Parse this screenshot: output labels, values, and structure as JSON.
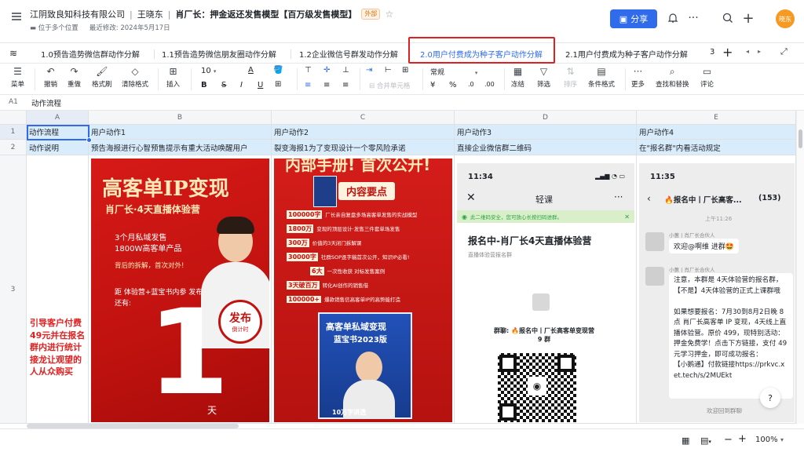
{
  "header": {
    "org": "江阴致良知科技有限公司",
    "author": "王晓东",
    "doc_title": "肖厂长：押金返还发售模型【百万级发售模型】",
    "badge": "外部",
    "location": "位于多个位置",
    "modified": "最近修改: 2024年5月17日",
    "share_label": "分享",
    "avatar_text": "晓东"
  },
  "tabs": [
    {
      "label": "1.0预告造势微信群动作分解"
    },
    {
      "label": "1.1预告造势微信朋友圈动作分解"
    },
    {
      "label": "1.2企业微信号群发动作分解"
    },
    {
      "label": "2.0用户付费成为种子客户动作分解"
    },
    {
      "label": "2.1用户付费成为种子客户动作分解"
    },
    {
      "label": "3"
    }
  ],
  "toolbar": {
    "menu": "菜单",
    "undo": "撤销",
    "redo": "重做",
    "format_brush": "格式刷",
    "clear_format": "清除格式",
    "insert": "插入",
    "font_size": "10",
    "merge": "合并单元格",
    "number_format": "常规",
    "freeze": "冻结",
    "filter": "筛选",
    "sort": "排序",
    "cond_format": "条件格式",
    "more": "更多",
    "find_replace": "查找和替换",
    "comment": "评论"
  },
  "formula_bar": {
    "ref": "A1",
    "value": "动作流程"
  },
  "columns": [
    "A",
    "B",
    "C",
    "D",
    "E"
  ],
  "rows": [
    {
      "num": "1",
      "cells": [
        "动作流程",
        "用户动作1",
        "用户动作2",
        "用户动作3",
        "用户动作4"
      ]
    },
    {
      "num": "2",
      "cells": [
        "动作说明",
        "预告海报进行心智预售提示有重大活动唤醒用户",
        "裂变海报1为了变现设计一个零风险承诺",
        "直接企业微信群二维码",
        "在\"报名群\"内看活动规定"
      ]
    },
    {
      "num": "3",
      "cells": [
        "引导客户付费49元并在报名群内进行统计接龙让观望的人从众购买"
      ]
    }
  ],
  "poster1": {
    "title": "高客单IP变现",
    "sub": "肖厂长·4天直播体验营",
    "line1": "3个月私域发售",
    "line2": "1800W高客单产品",
    "line3": "背后的拆解，首次对外!",
    "line4": "距 体验营+蓝宝书内参 发布",
    "line5": "还有:",
    "big": "1",
    "unit": "天",
    "seal": "发布",
    "seal_sub": "倒计时"
  },
  "poster2": {
    "top": "内部手册! 首次公开!",
    "header": "内容要点",
    "items": [
      {
        "tag": "100000字",
        "text": "厂长亲自复盘多场高客单发售的实战模型"
      },
      {
        "tag": "1800万",
        "text": "变现的顶层设计·发售三件套单场发售"
      },
      {
        "tag": "300万",
        "text": "价值的3天闭门拆解课"
      },
      {
        "tag": "30000字",
        "text": "社群SOP逐字稿首次公开，知识IP必看!"
      },
      {
        "tag": "6大",
        "text": "一次性收获 对标发售案例"
      },
      {
        "tag": "3天破百万",
        "text": "转化AI创作的销售借"
      },
      {
        "tag": "100000+",
        "text": "爆款销售信高客单IP的高势能打造"
      }
    ],
    "book": "高客单私域变现",
    "book2": "蓝宝书2023版",
    "bottom": "10万字讲透"
  },
  "phone1": {
    "time": "11:34",
    "app": "轻课",
    "notice": "此二维码安全，您可放心长按扫码进群。",
    "title": "报名中-肖厂长4天直播体验营",
    "subtitle": "直播体验营报名群",
    "group_label": "群聊: 🔥报名中丨厂长高客单变现营 9 群"
  },
  "phone2": {
    "time": "11:35",
    "chat_title": "🔥报名中丨厂长高客...",
    "count": "(153)",
    "ts": "上午11:26",
    "sender": "小蕙丨肖厂长合伙人",
    "msg1": "欢迎@啊维 进群🤩",
    "msg2": "注意，本群是 4天体验营的报名群，【不是】4天体验营的正式上课群哦\n\n如果想要报名：7月30到8月2日晚 8点 肖厂长高客单 IP 变现，4天线上直播体验营。原价 499，现特别活动：押金免费学！点击下方链接，支付 49元学习押金，即可成功报名：\n【小鹅通】付款链接https://prkvc.xet.tech/s/2MUEkt",
    "footer": "欢迎回到群聊"
  },
  "zoom": "100%"
}
